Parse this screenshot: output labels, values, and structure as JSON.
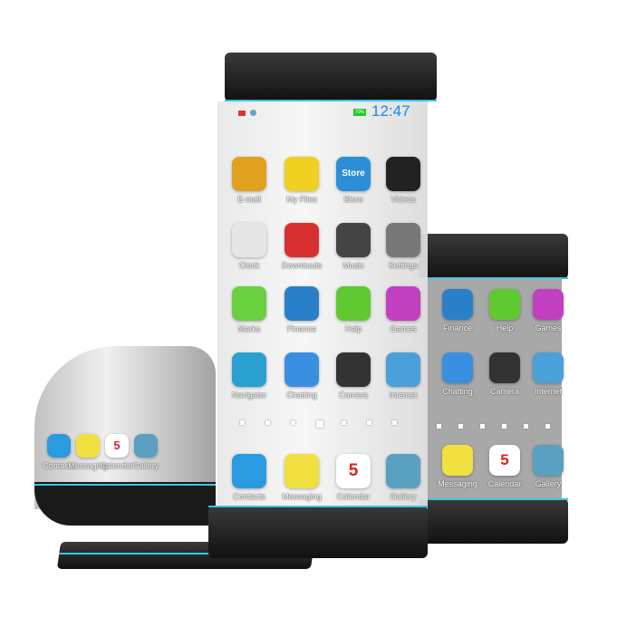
{
  "status_bar": {
    "time": "12:47",
    "battery": "70%"
  },
  "main_phone": {
    "apps": [
      {
        "label": "E-mail",
        "color": "#e0a020"
      },
      {
        "label": "My Files",
        "color": "#f0d020"
      },
      {
        "label": "Store",
        "color": "#2a8fd8",
        "text": "Store"
      },
      {
        "label": "Videos",
        "color": "#222222"
      },
      {
        "label": "Clock",
        "color": "#e6e6e6"
      },
      {
        "label": "Downloads",
        "color": "#d83030"
      },
      {
        "label": "Music",
        "color": "#444444"
      },
      {
        "label": "Settings",
        "color": "#777777"
      },
      {
        "label": "Marks",
        "color": "#6ad040"
      },
      {
        "label": "Finance",
        "color": "#2a80c8"
      },
      {
        "label": "Help",
        "color": "#60c830"
      },
      {
        "label": "Games",
        "color": "#c040c0"
      },
      {
        "label": "Navigator",
        "color": "#2aa0d0"
      },
      {
        "label": "Chatting",
        "color": "#3a90e0"
      },
      {
        "label": "Camera",
        "color": "#333333"
      },
      {
        "label": "Internet",
        "color": "#4aa0d8"
      }
    ],
    "dock": [
      {
        "label": "Contacts",
        "color": "#2a9be0"
      },
      {
        "label": "Messaging",
        "color": "#f0e040"
      },
      {
        "label": "Calendar",
        "color": "#ffffff",
        "text": "5"
      },
      {
        "label": "Gallery",
        "color": "#5aa0c0"
      }
    ]
  },
  "right_phone": {
    "apps": [
      {
        "label": "Finance",
        "color": "#2a80c8"
      },
      {
        "label": "Help",
        "color": "#60c830"
      },
      {
        "label": "Games",
        "color": "#c040c0"
      },
      {
        "label": "Chatting",
        "color": "#3a90e0"
      },
      {
        "label": "Camera",
        "color": "#333333"
      },
      {
        "label": "Internet",
        "color": "#4aa0d8"
      }
    ],
    "dock": [
      {
        "label": "Messaging",
        "color": "#f0e040"
      },
      {
        "label": "Calendar",
        "color": "#ffffff",
        "text": "5"
      },
      {
        "label": "Gallery",
        "color": "#5aa0c0"
      }
    ]
  },
  "curved_device": {
    "dock": [
      {
        "label": "Contacts",
        "color": "#2a9be0"
      },
      {
        "label": "Messaging",
        "color": "#f0e040"
      },
      {
        "label": "Calendar",
        "color": "#ffffff",
        "text": "5"
      },
      {
        "label": "Gallery",
        "color": "#5aa0c0"
      }
    ]
  },
  "colors": {
    "accent": "#36c6e8",
    "clock_text": "#1a8ae0",
    "body": "#1a1a1a"
  }
}
